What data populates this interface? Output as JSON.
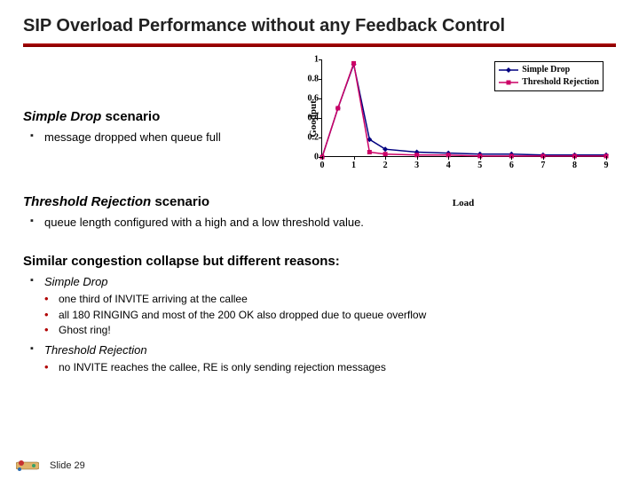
{
  "title": "SIP Overload Performance without any Feedback Control",
  "scenario1": {
    "heading_prefix": "Simple Drop",
    "heading_suffix": " scenario",
    "bullets": [
      "message dropped when queue full"
    ]
  },
  "scenario2": {
    "heading_prefix": "Threshold Rejection",
    "heading_suffix": " scenario",
    "bullets": [
      "queue length configured with a high and a low threshold value."
    ]
  },
  "similar": {
    "prefix": "Similar congestion collapse but ",
    "bold": "different",
    "suffix": " reasons:",
    "sd_heading": "Simple Drop",
    "sd_bullets": [
      "one third of INVITE arriving at the callee",
      "all 180 RINGING  and most of the 200 OK also dropped due to queue overflow",
      "Ghost ring!"
    ],
    "tr_heading": "Threshold Rejection",
    "tr_bullets": [
      "no INVITE reaches the callee, RE is only sending rejection messages"
    ]
  },
  "footer": {
    "slide": "Slide 29"
  },
  "chart_data": {
    "type": "line",
    "xlabel": "Load",
    "ylabel": "Goodput",
    "xlim": [
      0,
      9
    ],
    "ylim": [
      0,
      1
    ],
    "xticks": [
      0,
      1,
      2,
      3,
      4,
      5,
      6,
      7,
      8,
      9
    ],
    "yticks": [
      0,
      0.2,
      0.4,
      0.6,
      0.8,
      1
    ],
    "series": [
      {
        "name": "Simple Drop",
        "color": "#000080",
        "marker": "diamond",
        "x": [
          0,
          0.5,
          1,
          1.5,
          2,
          3,
          4,
          5,
          6,
          7,
          8,
          9
        ],
        "y": [
          0,
          0.5,
          0.95,
          0.18,
          0.08,
          0.05,
          0.04,
          0.03,
          0.03,
          0.02,
          0.02,
          0.02
        ]
      },
      {
        "name": "Threshold Rejection",
        "color": "#cc0066",
        "marker": "square",
        "x": [
          0,
          0.5,
          1,
          1.5,
          2,
          3,
          4,
          5,
          6,
          7,
          8,
          9
        ],
        "y": [
          0,
          0.5,
          0.96,
          0.05,
          0.03,
          0.02,
          0.02,
          0.01,
          0.01,
          0.01,
          0.01,
          0.01
        ]
      }
    ]
  }
}
